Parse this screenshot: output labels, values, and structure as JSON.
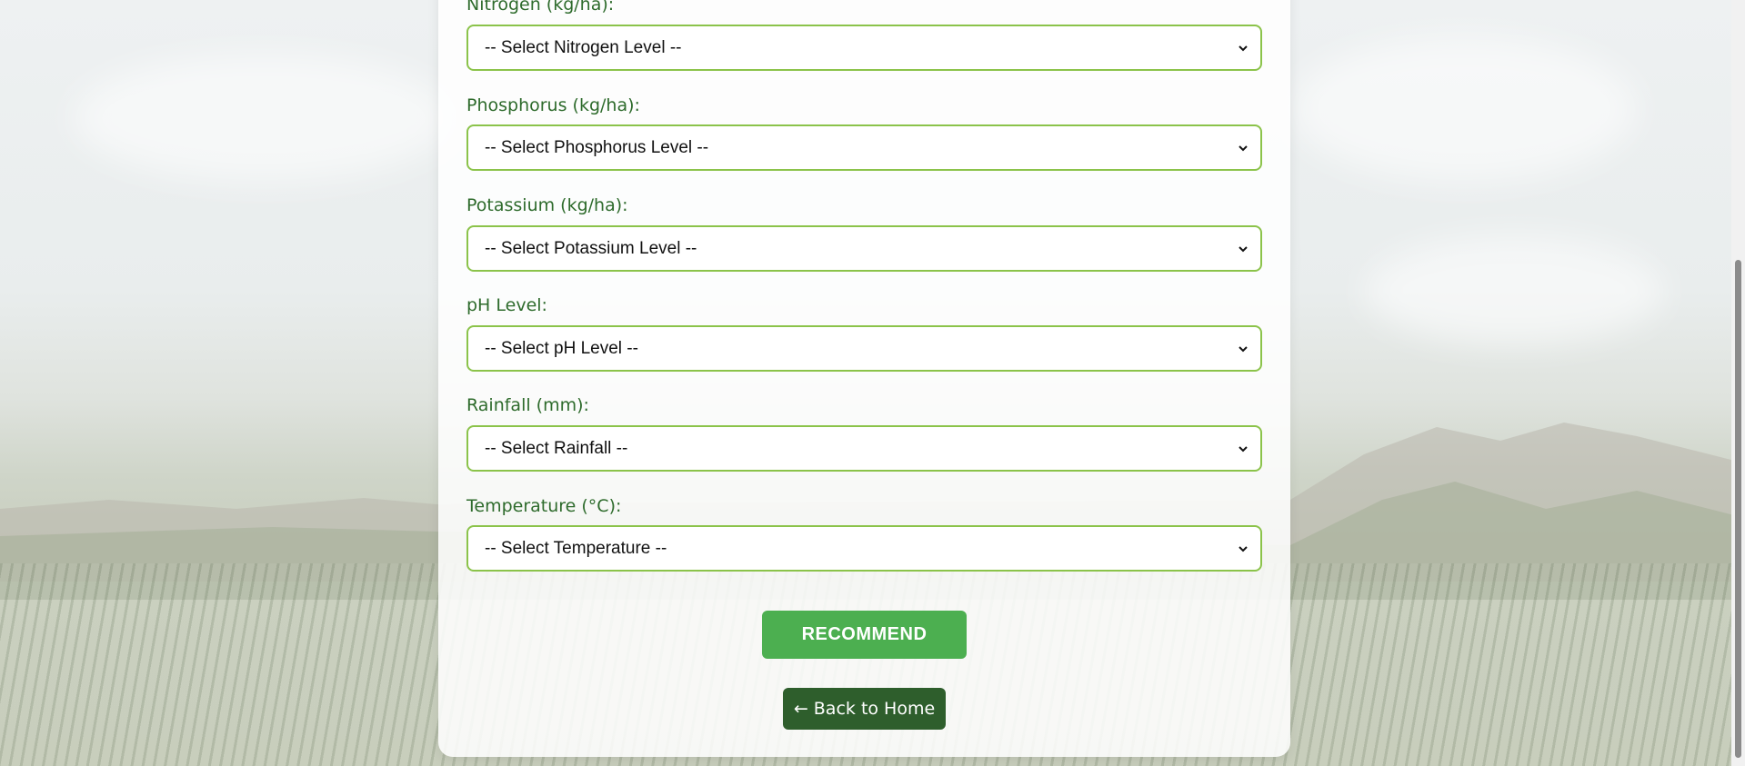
{
  "form": {
    "fields": [
      {
        "label": "Nitrogen (kg/ha):",
        "placeholder": "-- Select Nitrogen Level --"
      },
      {
        "label": "Phosphorus (kg/ha):",
        "placeholder": "-- Select Phosphorus Level --"
      },
      {
        "label": "Potassium (kg/ha):",
        "placeholder": "-- Select Potassium Level --"
      },
      {
        "label": "pH Level:",
        "placeholder": "-- Select pH Level --"
      },
      {
        "label": "Rainfall (mm):",
        "placeholder": "-- Select Rainfall --"
      },
      {
        "label": "Temperature (°C):",
        "placeholder": "-- Select Temperature --"
      }
    ],
    "submit_label": "RECOMMEND",
    "back_label": "← Back to Home"
  },
  "colors": {
    "label": "#2e6b2c",
    "select_border": "#8bc34a",
    "recommend_button": "#4caf50",
    "back_button": "#2e5e2c"
  }
}
